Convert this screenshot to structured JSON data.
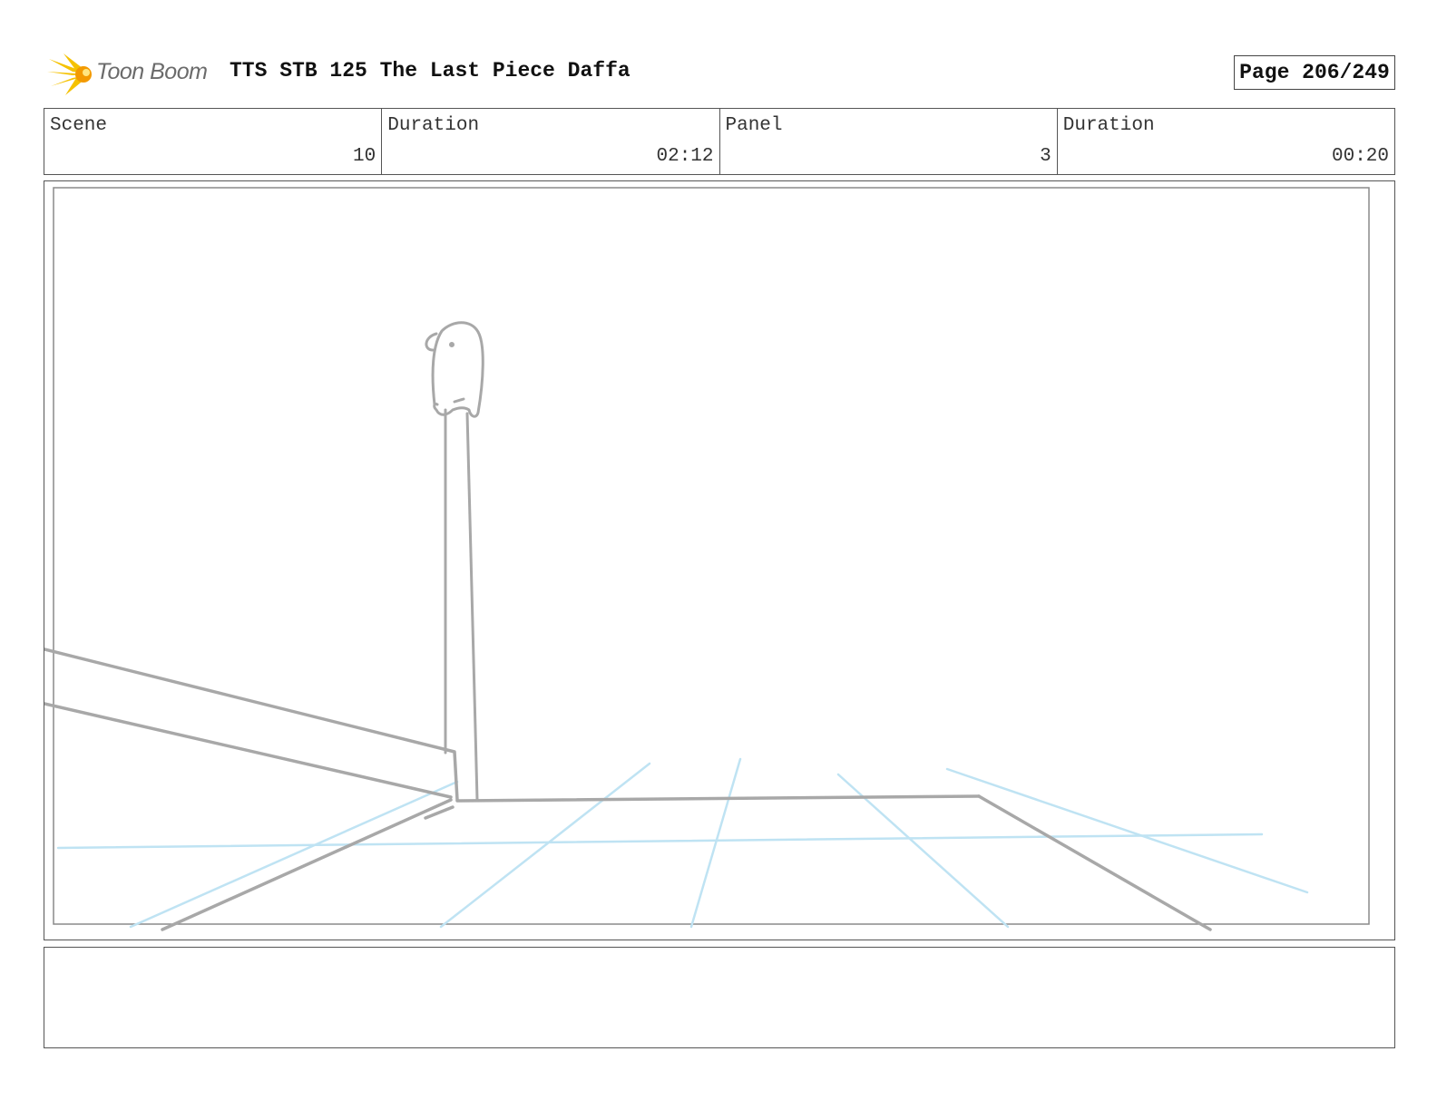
{
  "header": {
    "logo_text": "Toon Boom",
    "title": "TTS STB 125 The Last Piece Daffa",
    "page": "Page 206/249"
  },
  "info": [
    {
      "label": "Scene",
      "value": "10"
    },
    {
      "label": "Duration",
      "value": "02:12"
    },
    {
      "label": "Panel",
      "value": "3"
    },
    {
      "label": "Duration",
      "value": "00:20"
    }
  ],
  "colors": {
    "sketch_gray": "#a8a8a8",
    "guide_blue": "#bfe3f3",
    "logo_yellow": "#f5c200",
    "logo_orange": "#f39a00"
  },
  "notes": ""
}
